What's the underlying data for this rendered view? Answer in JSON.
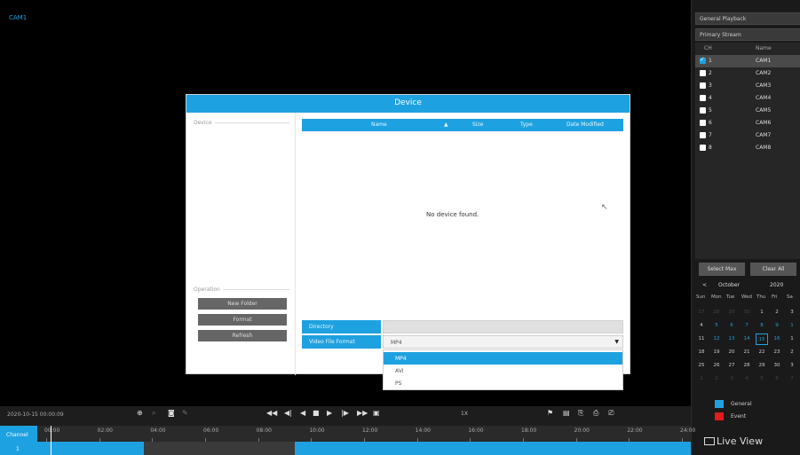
{
  "video": {
    "cam_label": "CAM1"
  },
  "right_panel": {
    "playback_mode": "General Playback",
    "stream": "Primary Stream",
    "table_head": {
      "ch": "CH",
      "name": "Name"
    },
    "channels": [
      {
        "num": "1",
        "name": "CAM1",
        "checked": true
      },
      {
        "num": "2",
        "name": "CAM2",
        "checked": false
      },
      {
        "num": "3",
        "name": "CAM3",
        "checked": false
      },
      {
        "num": "4",
        "name": "CAM4",
        "checked": false
      },
      {
        "num": "5",
        "name": "CAM5",
        "checked": false
      },
      {
        "num": "6",
        "name": "CAM6",
        "checked": false
      },
      {
        "num": "7",
        "name": "CAM7",
        "checked": false
      },
      {
        "num": "8",
        "name": "CAM8",
        "checked": false
      }
    ],
    "select_max": "Select Max",
    "clear_all": "Clear All",
    "calendar": {
      "prev": "<",
      "month": "October",
      "year": "2020",
      "weekdays": [
        "Sun",
        "Mon",
        "Tue",
        "Wed",
        "Thu",
        "Fri",
        "Sa"
      ],
      "rows": [
        [
          "27",
          "28",
          "29",
          "30",
          "1",
          "2",
          "3"
        ],
        [
          "4",
          "5",
          "6",
          "7",
          "8",
          "9",
          "1"
        ],
        [
          "11",
          "12",
          "13",
          "14",
          "15",
          "16",
          "1"
        ],
        [
          "18",
          "19",
          "20",
          "21",
          "22",
          "23",
          "2"
        ],
        [
          "25",
          "26",
          "27",
          "28",
          "29",
          "30",
          "3"
        ],
        [
          "1",
          "2",
          "3",
          "4",
          "5",
          "6",
          "7"
        ]
      ]
    },
    "legend_general": "General",
    "legend_event": "Event",
    "live_view": "Live View",
    "colors": {
      "general": "#1ea1e0",
      "event": "#e21b1b"
    }
  },
  "bottom": {
    "timestamp": "2020-10-15 00:00:09",
    "speed": "1X",
    "channel_label": "Channel",
    "channel_index": "1",
    "ticks": [
      "00:00",
      "02:00",
      "04:00",
      "06:00",
      "08:00",
      "10:00",
      "12:00",
      "14:00",
      "16:00",
      "18:00",
      "20:00",
      "22:00",
      "24:00"
    ]
  },
  "dialog": {
    "title": "Device",
    "device_label": "Device",
    "operation_label": "Operation",
    "buttons": {
      "new_folder": "New Folder",
      "format": "Format",
      "refresh": "Refresh"
    },
    "columns": {
      "name": "Name",
      "sort": "▲",
      "size": "Size",
      "type": "Type",
      "date": "Date Modified"
    },
    "empty_message": "No device found.",
    "directory_label": "Directory",
    "directory_value": "",
    "format_label": "Video File Format",
    "format_value": "MP4",
    "format_options": [
      "MP4",
      "AVI",
      "PS"
    ]
  }
}
